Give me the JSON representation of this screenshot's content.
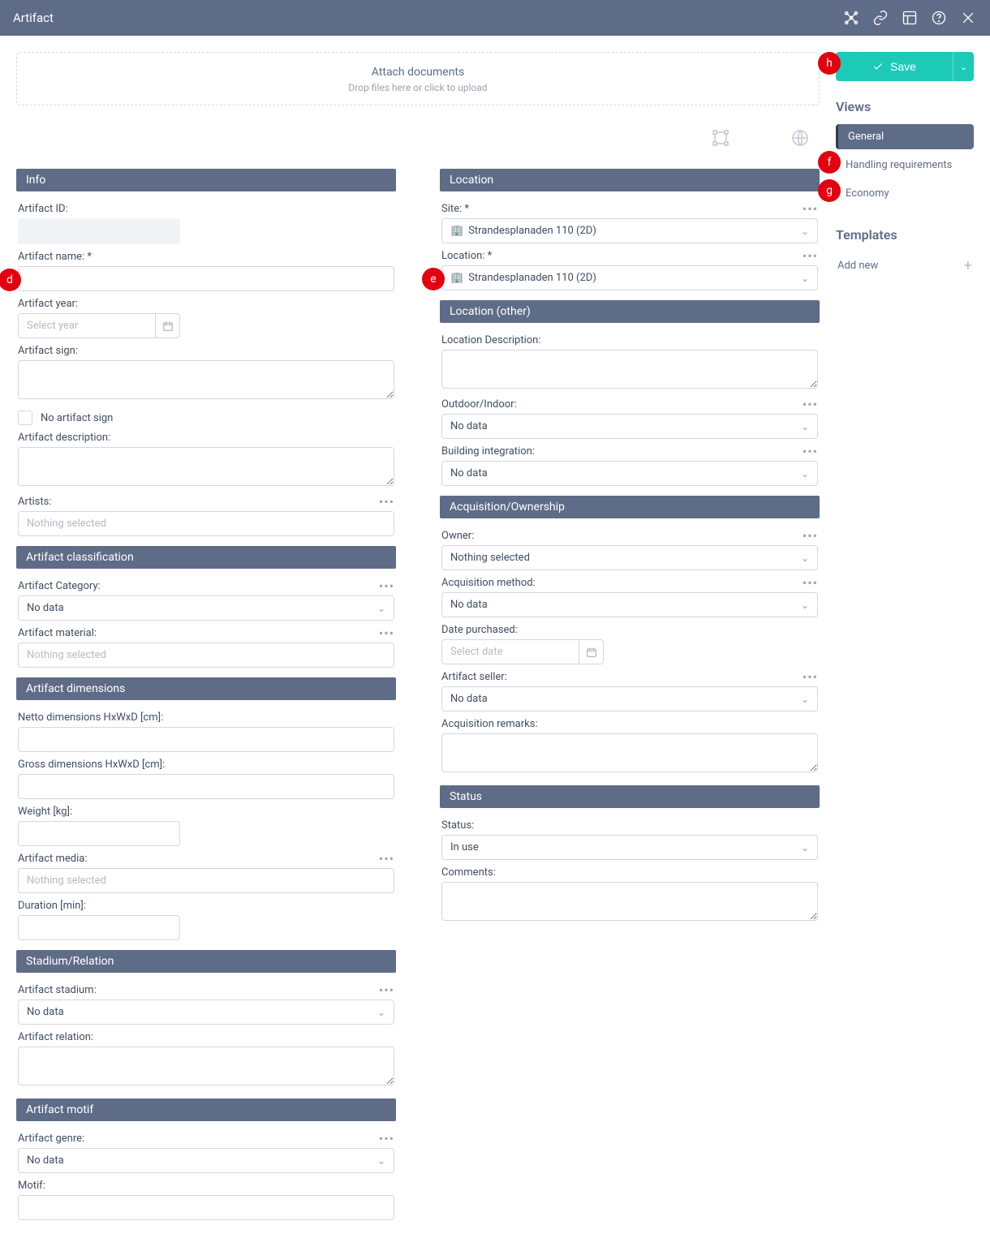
{
  "header": {
    "title": "Artifact"
  },
  "dropzone": {
    "title": "Attach documents",
    "subtitle": "Drop files here or click to upload"
  },
  "sidebar": {
    "save_label": "Save",
    "views_title": "Views",
    "views": {
      "general": "General",
      "handling": "Handling requirements",
      "economy": "Economy"
    },
    "templates_title": "Templates",
    "add_new": "Add new"
  },
  "markers": {
    "d": "d",
    "e": "e",
    "f": "f",
    "g": "g",
    "h": "h"
  },
  "sections": {
    "info": {
      "title": "Info",
      "artifact_id_label": "Artifact ID:",
      "artifact_name_label": "Artifact name: *",
      "artifact_year_label": "Artifact year:",
      "artifact_year_placeholder": "Select year",
      "artifact_sign_label": "Artifact sign:",
      "no_artifact_sign": "No artifact sign",
      "artifact_desc_label": "Artifact description:",
      "artists_label": "Artists:",
      "artists_placeholder": "Nothing selected"
    },
    "classification": {
      "title": "Artifact classification",
      "category_label": "Artifact Category:",
      "category_value": "No data",
      "material_label": "Artifact material:",
      "material_placeholder": "Nothing selected"
    },
    "dimensions": {
      "title": "Artifact dimensions",
      "netto_label": "Netto dimensions HxWxD [cm]:",
      "gross_label": "Gross dimensions HxWxD [cm]:",
      "weight_label": "Weight [kg]:",
      "media_label": "Artifact media:",
      "media_placeholder": "Nothing selected",
      "duration_label": "Duration [min]:"
    },
    "stadium": {
      "title": "Stadium/Relation",
      "stadium_label": "Artifact stadium:",
      "stadium_value": "No data",
      "relation_label": "Artifact relation:"
    },
    "motif": {
      "title": "Artifact motif",
      "genre_label": "Artifact genre:",
      "genre_value": "No data",
      "motif_label": "Motif:"
    },
    "location": {
      "title": "Location",
      "site_label": "Site: *",
      "site_value": "Strandesplanaden 110 (2D)",
      "location_label": "Location: *",
      "location_value": "Strandesplanaden 110 (2D)"
    },
    "location_other": {
      "title": "Location (other)",
      "desc_label": "Location Description:",
      "outdoor_label": "Outdoor/Indoor:",
      "outdoor_value": "No data",
      "integration_label": "Building integration:",
      "integration_value": "No data"
    },
    "acquisition": {
      "title": "Acquisition/Ownership",
      "owner_label": "Owner:",
      "owner_placeholder": "Nothing selected",
      "method_label": "Acquisition method:",
      "method_value": "No data",
      "date_label": "Date purchased:",
      "date_placeholder": "Select date",
      "seller_label": "Artifact seller:",
      "seller_value": "No data",
      "remarks_label": "Acquisition remarks:"
    },
    "status": {
      "title": "Status",
      "status_label": "Status:",
      "status_value": "In use",
      "comments_label": "Comments:"
    }
  }
}
